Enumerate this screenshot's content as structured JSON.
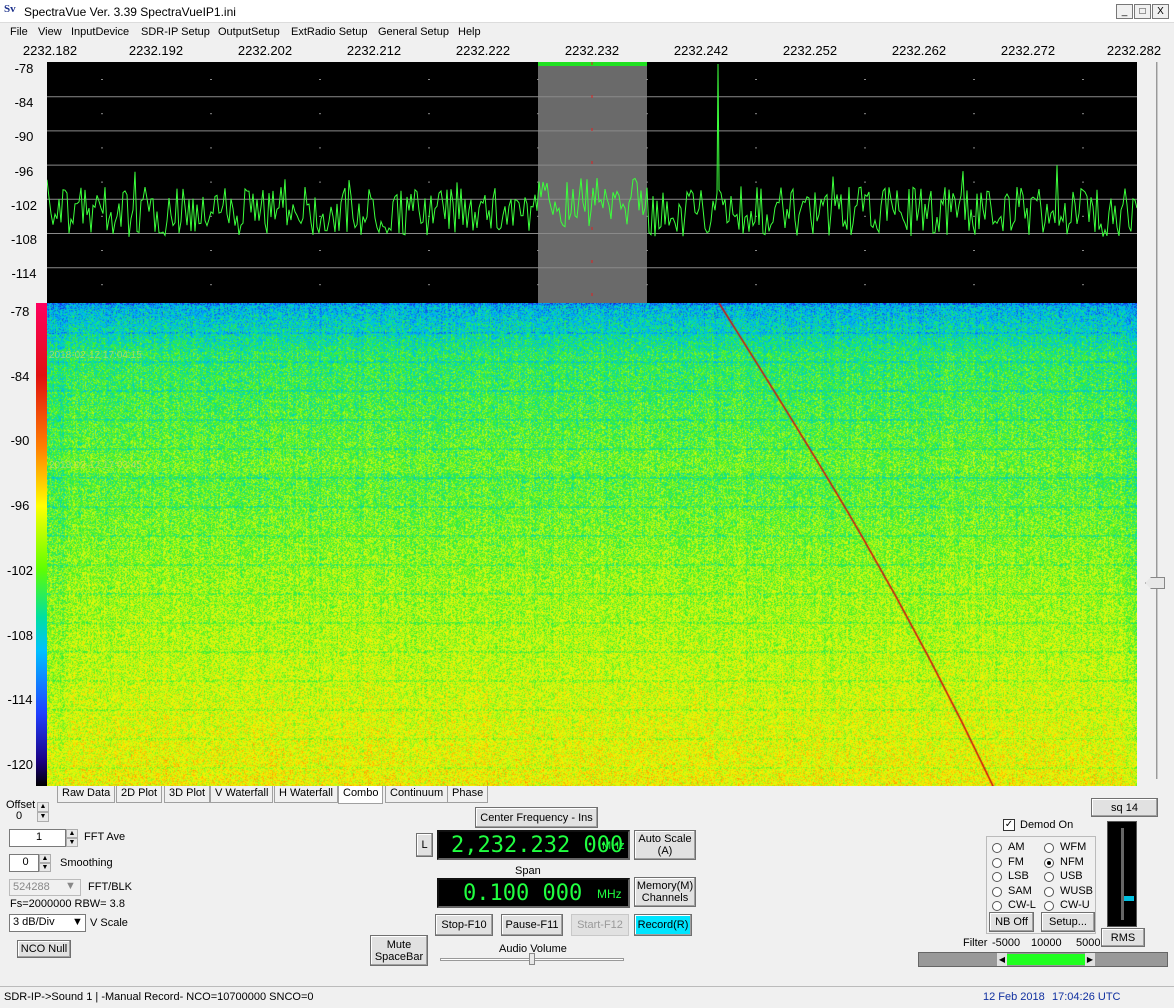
{
  "window": {
    "icon_text": "Sv",
    "title": "SpectraVue Ver. 3.39  SpectraVueIP1.ini",
    "minimize": "_",
    "restore": "□",
    "close": "X"
  },
  "menu": [
    "File",
    "View",
    "InputDevice",
    "SDR-IP Setup",
    "OutputSetup",
    "ExtRadio Setup",
    "General Setup",
    "Help"
  ],
  "freq_axis": [
    "2232.182",
    "2232.192",
    "2232.202",
    "2232.212",
    "2232.222",
    "2232.232",
    "2232.242",
    "2232.252",
    "2232.262",
    "2232.272",
    "2232.282"
  ],
  "spectrum_db_axis": [
    "-78",
    "-84",
    "-90",
    "-96",
    "-102",
    "-108",
    "-114"
  ],
  "waterfall_db_axis": [
    "-78",
    "-84",
    "-90",
    "-96",
    "-102",
    "-108",
    "-114",
    "-120"
  ],
  "waterfall_timestamps": [
    "2018-02-12 17:04:15",
    "2018-02-12 17:03:45"
  ],
  "colors": {
    "trace": "#3cff3c",
    "passband": "#6a6a6a",
    "passband_marker": "#20e020",
    "lcd_text": "#20ff40",
    "record_active": "#00e5ff",
    "waterfall_signal": "#d01010"
  },
  "tabs": [
    "Raw Data",
    "2D Plot",
    "3D Plot",
    "V Waterfall",
    "H Waterfall",
    "Combo",
    "Continuum",
    "Phase"
  ],
  "active_tab": "Combo",
  "controls": {
    "offset_label": "Offset",
    "offset_value": "0",
    "fft_ave_value": "1",
    "fft_ave_label": "FFT Ave",
    "smoothing_value": "0",
    "smoothing_label": "Smoothing",
    "fft_blk_value": "524288",
    "fft_blk_label": "FFT/BLK",
    "fs_info": "Fs=2000000 RBW= 3.8",
    "vscale_value": "3 dB/Div",
    "vscale_label": "V Scale",
    "nco_null": "NCO Null",
    "mute_line1": "Mute",
    "mute_line2": "SpaceBar",
    "center_freq_button": "Center Frequency - Ins",
    "l_button": "L",
    "center_freq_value": "2,232.232 000",
    "mhz": "MHz",
    "auto_scale_line1": "Auto Scale",
    "auto_scale_line2": "(A)",
    "span_label": "Span",
    "span_value": "0.100 000",
    "memory_line1": "Memory(M)",
    "memory_line2": "Channels",
    "stop": "Stop-F10",
    "pause": "Pause-F11",
    "start": "Start-F12",
    "record": "Record(R)",
    "audio_volume": "Audio Volume"
  },
  "demod": {
    "sq_button": "sq 14",
    "demod_on_label": "Demod On",
    "demod_on_checked": true,
    "modes_left": [
      "AM",
      "FM",
      "LSB",
      "SAM",
      "CW-L"
    ],
    "modes_right": [
      "WFM",
      "NFM",
      "USB",
      "WUSB",
      "CW-U"
    ],
    "selected_mode": "NFM",
    "nb_off": "NB Off",
    "setup": "Setup...",
    "rms": "RMS",
    "filter_label": "Filter",
    "filter_low": "-5000",
    "filter_width": "10000",
    "filter_high": "5000"
  },
  "status": {
    "left": "SDR-IP->Sound 1  | -Manual Record-   NCO=10700000  SNCO=0",
    "date": "12 Feb 2018",
    "time": "17:04:26 UTC"
  }
}
